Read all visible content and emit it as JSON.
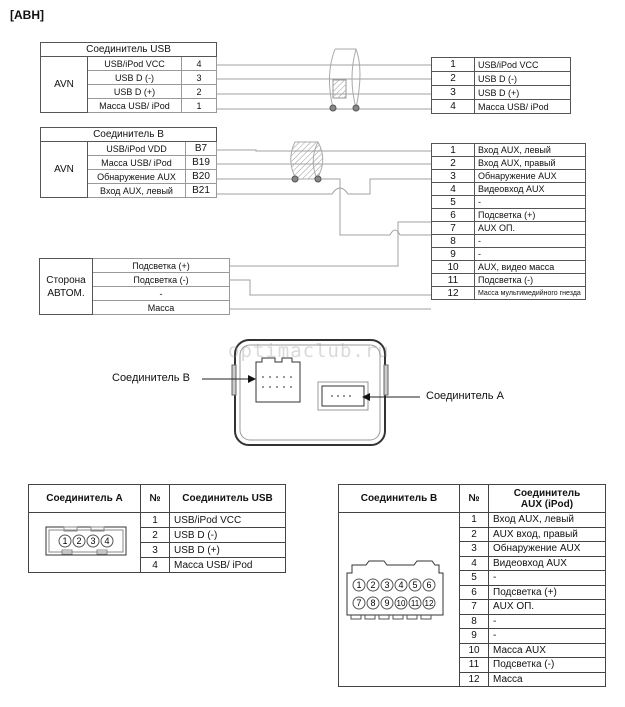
{
  "title": "[ABH]",
  "usb_block": {
    "header": "Соединитель USB",
    "side_label": "AVN",
    "rows": [
      {
        "signal": "USB/iPod VCC",
        "pin": "4"
      },
      {
        "signal": "USB D (-)",
        "pin": "3"
      },
      {
        "signal": "USB D (+)",
        "pin": "2"
      },
      {
        "signal": "Масса USB/ iPod",
        "pin": "1"
      }
    ]
  },
  "usb_out": {
    "rows": [
      {
        "pin": "1",
        "signal": "USB/iPod VCC"
      },
      {
        "pin": "2",
        "signal": "USB D (-)"
      },
      {
        "pin": "3",
        "signal": "USB D (+)"
      },
      {
        "pin": "4",
        "signal": "Масса USB/ iPod"
      }
    ]
  },
  "b_block": {
    "header": "Соединитель B",
    "side_label": "AVN",
    "rows": [
      {
        "signal": "USB/iPod VDD",
        "pin": "B7"
      },
      {
        "signal": "Масса USB/ iPod",
        "pin": "B19"
      },
      {
        "signal": "Обнаружение AUX",
        "pin": "B20"
      },
      {
        "signal": "Вход AUX, левый",
        "pin": "B21"
      }
    ]
  },
  "auto_block": {
    "side_label_1": "Сторона",
    "side_label_2": "АВТОМ.",
    "rows": [
      "Подсветка (+)",
      "Подсветка (-)",
      "-",
      "Масса"
    ]
  },
  "aux_out": {
    "rows": [
      {
        "pin": "1",
        "signal": "Вход AUX, левый"
      },
      {
        "pin": "2",
        "signal": "Вход AUX, правый"
      },
      {
        "pin": "3",
        "signal": "Обнаружение AUX"
      },
      {
        "pin": "4",
        "signal": "Видеовход AUX"
      },
      {
        "pin": "5",
        "signal": "-"
      },
      {
        "pin": "6",
        "signal": "Подсветка (+)"
      },
      {
        "pin": "7",
        "signal": "AUX ОП."
      },
      {
        "pin": "8",
        "signal": "-"
      },
      {
        "pin": "9",
        "signal": "-"
      },
      {
        "pin": "10",
        "signal": "AUX, видео масса"
      },
      {
        "pin": "11",
        "signal": "Подсветка (-)"
      },
      {
        "pin": "12",
        "signal": "Масса мультимедийного гнезда"
      }
    ]
  },
  "connector_figure": {
    "label_b": "Соединитель B",
    "label_a": "Соединитель A",
    "watermark": "optimaclub.ru"
  },
  "table_a": {
    "headers": [
      "Соединитель A",
      "№",
      "Соединитель USB"
    ],
    "pin_glyphs": [
      "1",
      "2",
      "3",
      "4"
    ],
    "rows": [
      {
        "no": "1",
        "name": "USB/iPod VCC"
      },
      {
        "no": "2",
        "name": "USB D (-)"
      },
      {
        "no": "3",
        "name": "USB D (+)"
      },
      {
        "no": "4",
        "name": "Масса USB/ iPod"
      }
    ]
  },
  "table_b": {
    "headers": [
      "Соединитель B",
      "№",
      "Соединитель AUX (iPod)"
    ],
    "header_line1": "Соединитель",
    "header_line2": "AUX (iPod)",
    "pin_glyphs_top": [
      "1",
      "2",
      "3",
      "4",
      "5",
      "6"
    ],
    "pin_glyphs_bottom": [
      "7",
      "8",
      "9",
      "10",
      "11",
      "12"
    ],
    "rows": [
      {
        "no": "1",
        "name": "Вход AUX, левый"
      },
      {
        "no": "2",
        "name": "AUX вход, правый"
      },
      {
        "no": "3",
        "name": "Обнаружение AUX"
      },
      {
        "no": "4",
        "name": "Видеовход AUX"
      },
      {
        "no": "5",
        "name": "-"
      },
      {
        "no": "6",
        "name": "Подсветка (+)"
      },
      {
        "no": "7",
        "name": "AUX ОП."
      },
      {
        "no": "8",
        "name": "-"
      },
      {
        "no": "9",
        "name": "-"
      },
      {
        "no": "10",
        "name": "Масса AUX"
      },
      {
        "no": "11",
        "name": "Подсветка (-)"
      },
      {
        "no": "12",
        "name": "Масса"
      }
    ]
  },
  "colors": {
    "wire": "#9a9a9a",
    "border": "#555555",
    "shield_hatch": "#888888"
  }
}
